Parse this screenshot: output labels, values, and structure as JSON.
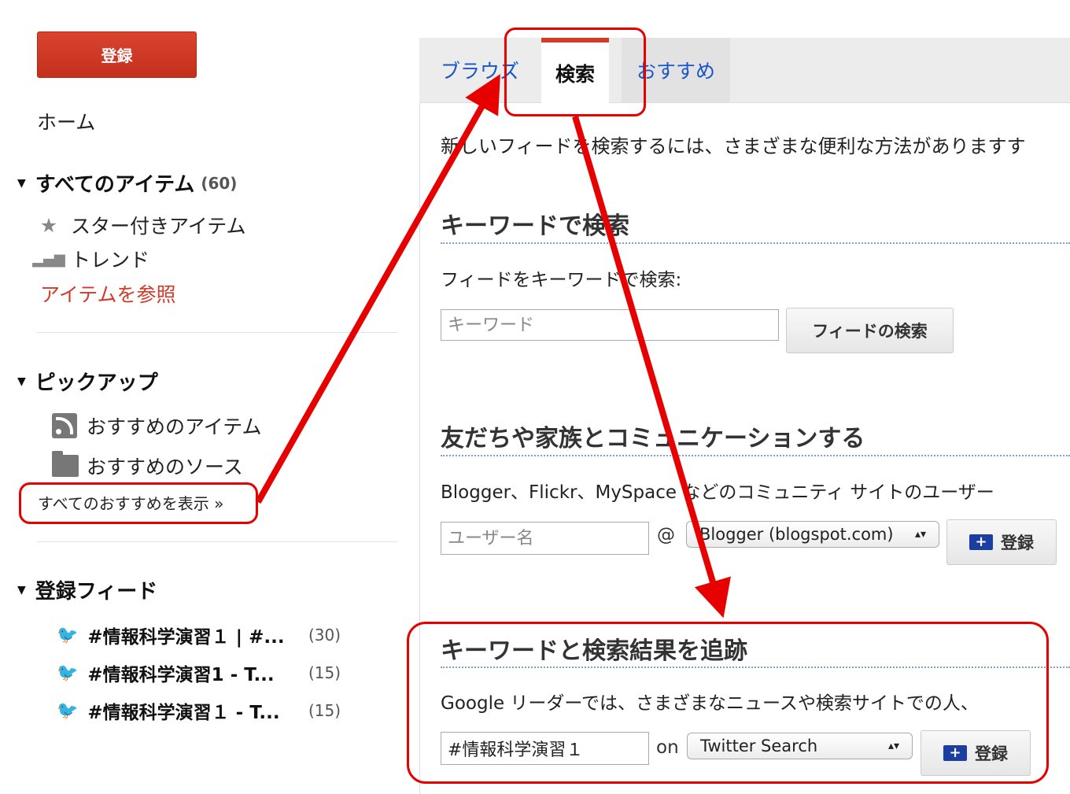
{
  "sidebar": {
    "subscribe_label": "登録",
    "home_label": "ホーム",
    "all_items": {
      "label": "すべてのアイテム",
      "count": "(60)"
    },
    "starred_label": "スター付きアイテム",
    "trends_label": "トレンド",
    "browse_label": "アイテムを参照",
    "pickup_heading": "ピックアップ",
    "recommended_items_label": "おすすめのアイテム",
    "recommended_sources_label": "おすすめのソース",
    "show_all_label": "すべてのおすすめを表示 »",
    "subscriptions_heading": "登録フィード",
    "feeds": [
      {
        "title": "#情報科学演習１ | #...",
        "count": "(30)"
      },
      {
        "title": "#情報科学演習1 - T...",
        "count": "(15)"
      },
      {
        "title": "#情報科学演習１ - T...",
        "count": "(15)"
      }
    ]
  },
  "tabs": [
    {
      "label": "ブラウズ"
    },
    {
      "label": "検索"
    },
    {
      "label": "おすすめ"
    }
  ],
  "main": {
    "intro": "新しいフィードを検索するには、さまざまな便利な方法がありますす",
    "keyword": {
      "heading": "キーワードで検索",
      "desc": "フィードをキーワードで検索:",
      "placeholder": "キーワード",
      "button": "フィードの検索"
    },
    "friends": {
      "heading": "友だちや家族とコミュニケーションする",
      "desc": "Blogger、Flickr、MySpace などのコミュニティ サイトのユーザー",
      "placeholder": "ユーザー名",
      "at": "@",
      "service": "Blogger (blogspot.com)",
      "button": "登録"
    },
    "track": {
      "heading": "キーワードと検索結果を追跡",
      "desc": "Google リーダーでは、さまざまなニュースや検索サイトでの人、",
      "value": "#情報科学演習１",
      "on": "on",
      "service": "Twitter Search",
      "button": "登録"
    }
  },
  "colors": {
    "accent_red": "#d23b2a",
    "link_blue": "#1a55c9",
    "annotation_red": "#e60000",
    "twitter_blue": "#2aa3e0"
  }
}
